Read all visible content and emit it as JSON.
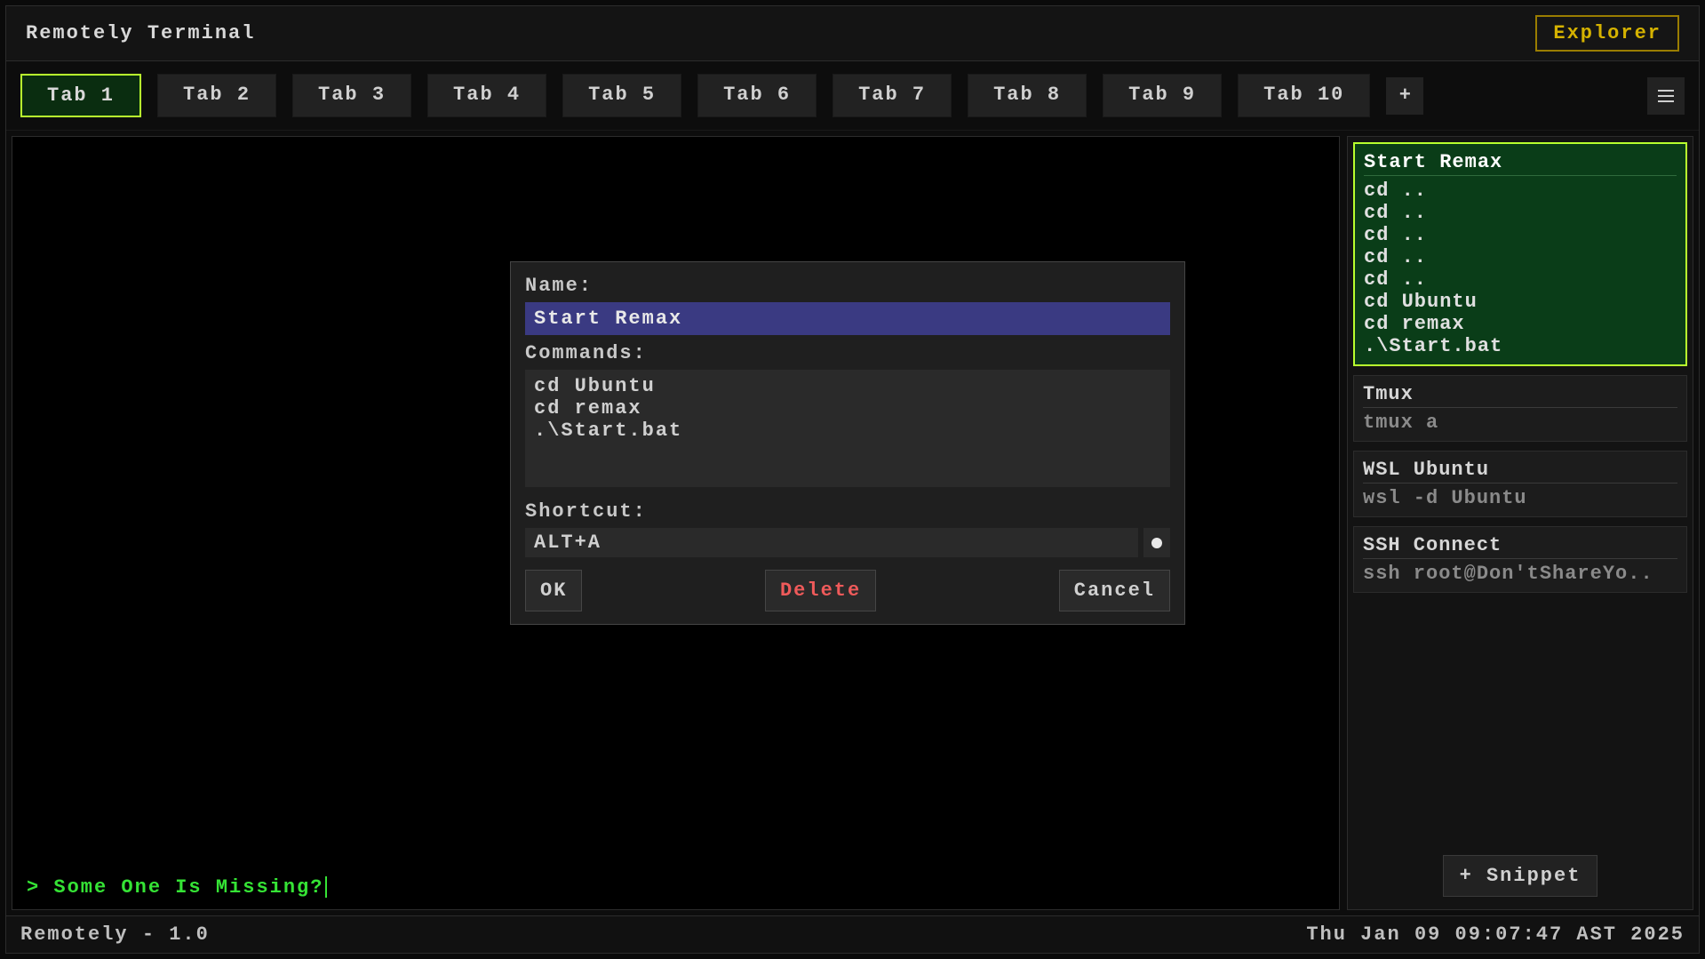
{
  "header": {
    "title": "Remotely Terminal",
    "explorer_label": "Explorer"
  },
  "tabs": {
    "items": [
      {
        "label": "Tab 1",
        "active": true
      },
      {
        "label": "Tab 2",
        "active": false
      },
      {
        "label": "Tab 3",
        "active": false
      },
      {
        "label": "Tab 4",
        "active": false
      },
      {
        "label": "Tab 5",
        "active": false
      },
      {
        "label": "Tab 6",
        "active": false
      },
      {
        "label": "Tab 7",
        "active": false
      },
      {
        "label": "Tab 8",
        "active": false
      },
      {
        "label": "Tab 9",
        "active": false
      },
      {
        "label": "Tab 10",
        "active": false
      }
    ],
    "plus_label": "+"
  },
  "terminal": {
    "prompt_prefix": "> ",
    "prompt_text": "Some One Is Missing?"
  },
  "dialog": {
    "name_label": "Name:",
    "name_value": "Start Remax",
    "commands_label": "Commands:",
    "commands_value": "cd Ubuntu\ncd remax\n.\\Start.bat",
    "shortcut_label": "Shortcut:",
    "shortcut_value": "ALT+A",
    "ok_label": "OK",
    "delete_label": "Delete",
    "cancel_label": "Cancel"
  },
  "snippets": {
    "items": [
      {
        "title": "Start Remax",
        "body": "cd ..\ncd ..\ncd ..\ncd ..\ncd ..\ncd Ubuntu\ncd remax\n.\\Start.bat",
        "active": true
      },
      {
        "title": "Tmux",
        "body": "tmux a",
        "active": false
      },
      {
        "title": "WSL Ubuntu",
        "body": "wsl -d Ubuntu",
        "active": false
      },
      {
        "title": "SSH Connect",
        "body": "ssh root@Don'tShareYo..",
        "active": false
      }
    ],
    "add_label": "+ Snippet"
  },
  "status": {
    "left": "Remotely - 1.0",
    "right": "Thu Jan 09 09:07:47 AST 2025"
  }
}
